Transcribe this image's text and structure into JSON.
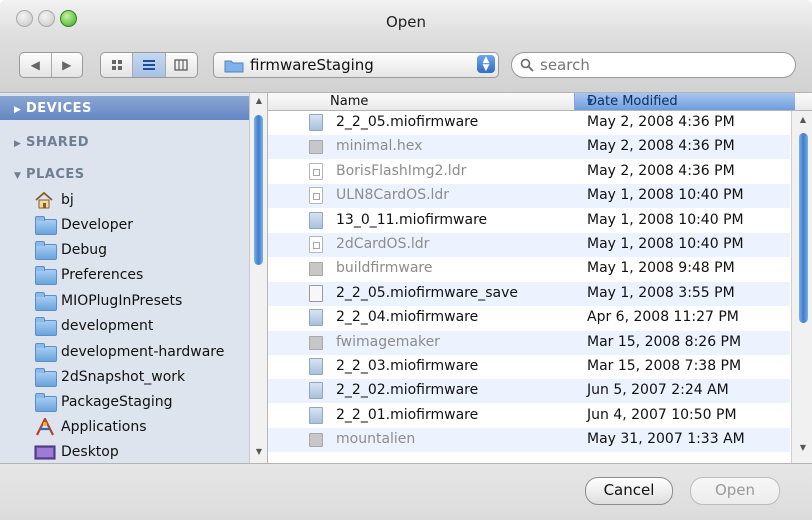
{
  "window": {
    "title": "Open"
  },
  "toolbar": {
    "back_icon": "back-arrow-icon",
    "forward_icon": "forward-arrow-icon",
    "view_modes": [
      "icon-view",
      "list-view",
      "column-view"
    ],
    "active_view": "list-view",
    "location": "firmwareStaging",
    "search_placeholder": "search"
  },
  "sidebar": {
    "sections": {
      "devices": "DEVICES",
      "shared": "SHARED",
      "places": "PLACES"
    },
    "places": [
      {
        "label": "bj",
        "icon": "home-icon"
      },
      {
        "label": "Developer",
        "icon": "folder-icon"
      },
      {
        "label": "Debug",
        "icon": "folder-icon"
      },
      {
        "label": "Preferences",
        "icon": "folder-icon"
      },
      {
        "label": "MIOPlugInPresets",
        "icon": "folder-icon"
      },
      {
        "label": "development",
        "icon": "folder-icon"
      },
      {
        "label": "development-hardware",
        "icon": "folder-icon"
      },
      {
        "label": "2dSnapshot_work",
        "icon": "folder-icon"
      },
      {
        "label": "PackageStaging",
        "icon": "folder-icon"
      },
      {
        "label": "Applications",
        "icon": "applications-icon"
      },
      {
        "label": "Desktop",
        "icon": "desktop-icon"
      }
    ]
  },
  "filelist": {
    "columns": {
      "name": "Name",
      "date": "Date Modified"
    },
    "rows": [
      {
        "name": "2_2_05.miofirmware",
        "date": "May 2, 2008 4:36 PM",
        "icon": "firmware-doc-icon",
        "enabled": true
      },
      {
        "name": "minimal.hex",
        "date": "May 2, 2008 4:36 PM",
        "icon": "unix-file-icon",
        "enabled": false
      },
      {
        "name": "BorisFlashImg2.ldr",
        "date": "May 2, 2008 4:36 PM",
        "icon": "ldr-file-icon",
        "enabled": false
      },
      {
        "name": "ULN8CardOS.ldr",
        "date": "May 1, 2008 10:40 PM",
        "icon": "ldr-file-icon",
        "enabled": false
      },
      {
        "name": "13_0_11.miofirmware",
        "date": "May 1, 2008 10:40 PM",
        "icon": "firmware-doc-icon",
        "enabled": true
      },
      {
        "name": "2dCardOS.ldr",
        "date": "May 1, 2008 10:40 PM",
        "icon": "ldr-file-icon",
        "enabled": false
      },
      {
        "name": "buildfirmware",
        "date": "May 1, 2008 9:48 PM",
        "icon": "unix-file-icon",
        "enabled": false
      },
      {
        "name": "2_2_05.miofirmware_save",
        "date": "May 1, 2008 3:55 PM",
        "icon": "blank-doc-icon",
        "enabled": true
      },
      {
        "name": "2_2_04.miofirmware",
        "date": "Apr 6, 2008 11:27 PM",
        "icon": "firmware-doc-icon",
        "enabled": true
      },
      {
        "name": "fwimagemaker",
        "date": "Mar 15, 2008 8:26 PM",
        "icon": "unix-file-icon",
        "enabled": false
      },
      {
        "name": "2_2_03.miofirmware",
        "date": "Mar 15, 2008 7:38 PM",
        "icon": "firmware-doc-icon",
        "enabled": true
      },
      {
        "name": "2_2_02.miofirmware",
        "date": "Jun 5, 2007 2:24 AM",
        "icon": "firmware-doc-icon",
        "enabled": true
      },
      {
        "name": "2_2_01.miofirmware",
        "date": "Jun 4, 2007 10:50 PM",
        "icon": "firmware-doc-icon",
        "enabled": true
      },
      {
        "name": "mountalien",
        "date": "May 31, 2007 1:33 AM",
        "icon": "unix-file-icon",
        "enabled": false
      }
    ]
  },
  "buttons": {
    "cancel": "Cancel",
    "open": "Open"
  }
}
